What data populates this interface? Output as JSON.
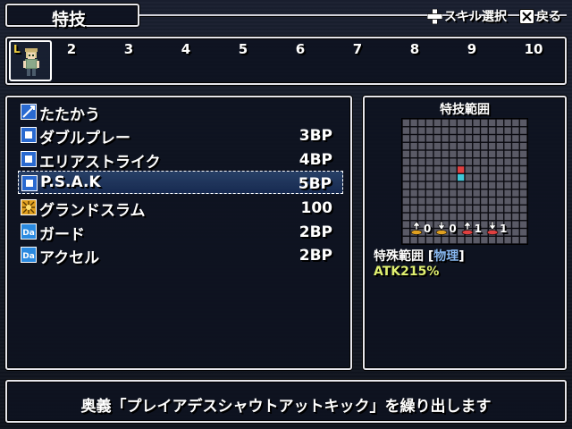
{
  "header": {
    "title": "特技",
    "hint_select": "スキル選択",
    "hint_back": "戻る"
  },
  "slots": {
    "leader_label": "L",
    "numbers": [
      "2",
      "3",
      "4",
      "5",
      "6",
      "7",
      "8",
      "9",
      "10"
    ]
  },
  "skills": [
    {
      "name": "たたかう",
      "cost": "",
      "icon": "attack-icon"
    },
    {
      "name": "ダブルプレー",
      "cost": "3BP",
      "icon": "skill-icon"
    },
    {
      "name": "エリアストライク",
      "cost": "4BP",
      "icon": "skill-icon"
    },
    {
      "name": "P.S.A.K",
      "cost": "5BP",
      "icon": "skill-icon",
      "selected": true
    },
    {
      "name": "グランドスラム",
      "cost": "100",
      "icon": "special-icon"
    },
    {
      "name": "ガード",
      "cost": "2BP",
      "icon": "da-icon"
    },
    {
      "name": "アクセル",
      "cost": "2BP",
      "icon": "da-icon"
    }
  ],
  "range": {
    "title": "特技範囲",
    "counts": [
      "0",
      "0",
      "1",
      "1"
    ],
    "special_label": "特殊範囲 [",
    "special_type": "物理",
    "special_close": "]",
    "atk": "ATK215%"
  },
  "description": "奥義「プレイアデスシャウトアットキック」を繰り出します",
  "colors": {
    "panel_border": "#e6e6ec",
    "panel_bg": "#0e1220",
    "grid_cell": "#5a5a66",
    "target_red": "#e04040",
    "target_cyan": "#40c8d8",
    "atk_text": "#e0f070",
    "phys_text": "#88b8f0"
  }
}
